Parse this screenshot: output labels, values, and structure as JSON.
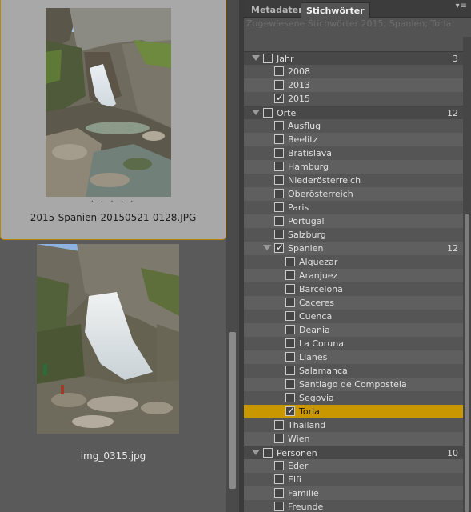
{
  "thumbnails": [
    {
      "filename": "2015-Spanien-20150521-0128.JPG",
      "selected": true,
      "rating_dots": "· · · · ·"
    },
    {
      "filename": "img_0315.jpg",
      "selected": false,
      "rating_dots": ""
    }
  ],
  "panel": {
    "tabs": [
      {
        "label": "Metadaten",
        "active": false
      },
      {
        "label": "Stichwörter",
        "active": true
      }
    ],
    "menu_icon": "panel-menu-icon",
    "menu_glyph": "▾≡",
    "assigned_keywords": "Zugewiesene Stichwörter 2015; Spanien; Torla",
    "tree": [
      {
        "label": "Jahr",
        "level": 0,
        "group": true,
        "expanded": true,
        "checked": false,
        "count": "3"
      },
      {
        "label": "2008",
        "level": 1,
        "checked": false
      },
      {
        "label": "2013",
        "level": 1,
        "checked": false
      },
      {
        "label": "2015",
        "level": 1,
        "checked": true
      },
      {
        "label": "Orte",
        "level": 0,
        "group": true,
        "expanded": true,
        "checked": false,
        "count": "12"
      },
      {
        "label": "Ausflug",
        "level": 1,
        "checked": false
      },
      {
        "label": "Beelitz",
        "level": 1,
        "checked": false
      },
      {
        "label": "Bratislava",
        "level": 1,
        "checked": false
      },
      {
        "label": "Hamburg",
        "level": 1,
        "checked": false
      },
      {
        "label": "Niederösterreich",
        "level": 1,
        "checked": false
      },
      {
        "label": "Oberösterreich",
        "level": 1,
        "checked": false
      },
      {
        "label": "Paris",
        "level": 1,
        "checked": false
      },
      {
        "label": "Portugal",
        "level": 1,
        "checked": false
      },
      {
        "label": "Salzburg",
        "level": 1,
        "checked": false
      },
      {
        "label": "Spanien",
        "level": 1,
        "group": true,
        "expanded": true,
        "checked": true,
        "count": "12"
      },
      {
        "label": "Alquezar",
        "level": 2,
        "checked": false
      },
      {
        "label": "Aranjuez",
        "level": 2,
        "checked": false
      },
      {
        "label": "Barcelona",
        "level": 2,
        "checked": false
      },
      {
        "label": "Caceres",
        "level": 2,
        "checked": false
      },
      {
        "label": "Cuenca",
        "level": 2,
        "checked": false
      },
      {
        "label": "Deania",
        "level": 2,
        "checked": false
      },
      {
        "label": "La Coruna",
        "level": 2,
        "checked": false
      },
      {
        "label": "Llanes",
        "level": 2,
        "checked": false
      },
      {
        "label": "Salamanca",
        "level": 2,
        "checked": false
      },
      {
        "label": "Santiago de Compostela",
        "level": 2,
        "checked": false
      },
      {
        "label": "Segovia",
        "level": 2,
        "checked": false
      },
      {
        "label": "Torla",
        "level": 2,
        "checked": true,
        "selected": true
      },
      {
        "label": "Thailand",
        "level": 1,
        "checked": false
      },
      {
        "label": "Wien",
        "level": 1,
        "checked": false
      },
      {
        "label": "Personen",
        "level": 0,
        "group": true,
        "expanded": true,
        "checked": false,
        "count": "10"
      },
      {
        "label": "Eder",
        "level": 1,
        "checked": false
      },
      {
        "label": "Elfi",
        "level": 1,
        "checked": false
      },
      {
        "label": "Familie",
        "level": 1,
        "checked": false
      },
      {
        "label": "Freunde",
        "level": 1,
        "checked": false
      }
    ]
  },
  "colors": {
    "selection": "#c99700",
    "selected_border": "#b8870a",
    "panel_bg": "#535353"
  }
}
